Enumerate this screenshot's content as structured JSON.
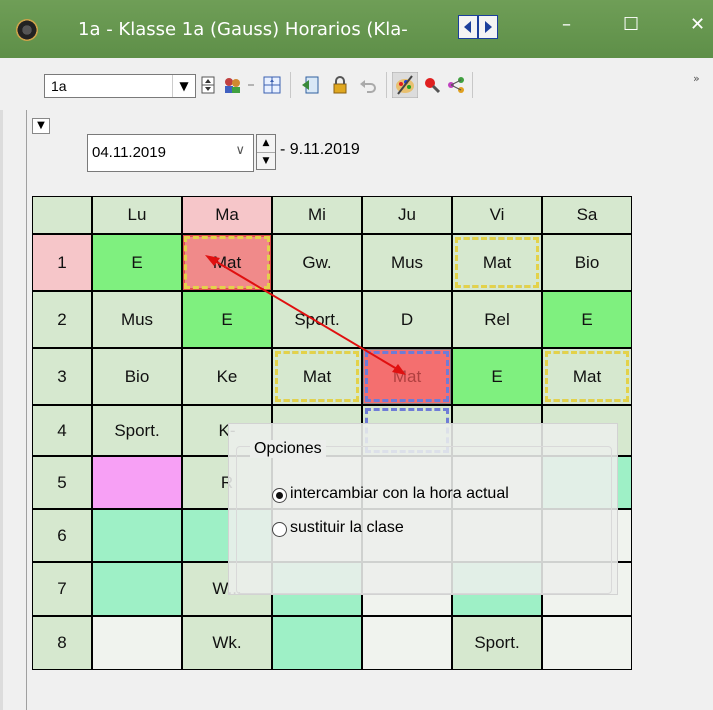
{
  "window": {
    "title": "1a - Klasse 1a (Gauss)  Horarios  (Kla-",
    "nav_prev": "◀",
    "nav_next": "▶",
    "minimize": "–",
    "maximize": "☐",
    "close": "✕"
  },
  "toolbar": {
    "class_value": "1a",
    "dropdown_arrow": "▼",
    "overflow": "»"
  },
  "date_range": {
    "start": "04.11.2019",
    "end": "- 9.11.2019",
    "spin_up": "▲",
    "spin_down": "▼",
    "collapse": "▼",
    "dropdown": "∨"
  },
  "timetable": {
    "days": [
      "Lu",
      "Ma",
      "Mi",
      "Ju",
      "Vi",
      "Sa"
    ],
    "periods": [
      "1",
      "2",
      "3",
      "4",
      "5",
      "6",
      "7",
      "8"
    ],
    "rows": [
      [
        "E",
        "Mat",
        "Gw.",
        "Mus",
        "Mat",
        "Bio"
      ],
      [
        "Mus",
        "E",
        "Sport.",
        "D",
        "Rel",
        "E"
      ],
      [
        "Bio",
        "Ke",
        "Mat",
        "Mat",
        "E",
        "Mat"
      ],
      [
        "Sport.",
        "K-",
        "",
        "",
        "",
        ""
      ],
      [
        "",
        "R",
        "",
        "",
        "",
        ""
      ],
      [
        "",
        "",
        "",
        "",
        "",
        ""
      ],
      [
        "",
        "W...",
        "",
        "",
        "",
        ""
      ],
      [
        "",
        "Wk.",
        "",
        "",
        "Sport.",
        ""
      ]
    ],
    "colors": {
      "header_bg": "#d6e8cf",
      "header_highlight": "#f6c6c9",
      "green_cell": "#7ff07f",
      "light_cell": "#d6e8cf",
      "mint_cell": "#9ef0c6",
      "pink_cell": "#f7a0f5",
      "selected_cell": "#f08a8a",
      "drop_target": "#f46f6f",
      "empty_cell": "#f0f3ee",
      "arrow": "#e01010"
    }
  },
  "options_dialog": {
    "title": "Opciones",
    "option_swap": "intercambiar con la hora actual",
    "option_replace": "sustituir la clase",
    "selected": "swap"
  }
}
